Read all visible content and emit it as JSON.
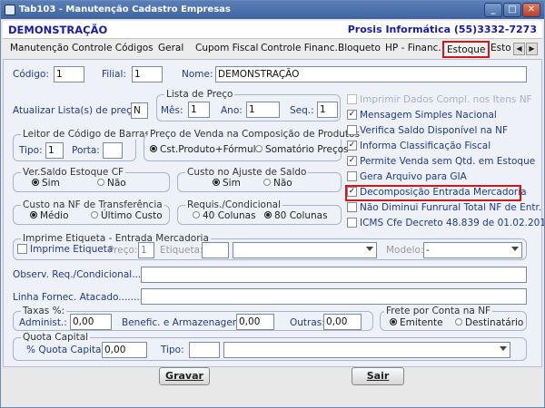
{
  "window": {
    "title": "Tab103 - Manutenção Cadastro Empresas"
  },
  "header": {
    "company": "DEMONSTRAÇÃO",
    "vendor": "Prosis Informática (55)3332-7273"
  },
  "tabs": [
    "Manutenção",
    "Controle Códigos",
    "Geral",
    "Cupom Fiscal",
    "Controle Financ.",
    "Bloqueto",
    "HP - Financ.",
    "Estoque",
    "Esto"
  ],
  "active_tab": "Estoque",
  "fields": {
    "codigo_label": "Código:",
    "codigo_value": "1",
    "filial_label": "Filial:",
    "filial_value": "1",
    "nome_label": "Nome:",
    "nome_value": "DEMONSTRAÇÃO",
    "atualizar_label": "Atualizar Lista(s) de preço:",
    "atualizar_value": "N"
  },
  "lista_preco": {
    "title": "Lista de Preço",
    "mes_label": "Mês:",
    "mes_value": "1",
    "ano_label": "Ano:",
    "ano_value": "1",
    "seq_label": "Seq.:",
    "seq_value": "1"
  },
  "leitor": {
    "title": "Leitor de Código de Barras",
    "tipo_label": "Tipo:",
    "tipo_value": "1",
    "porta_label": "Porta:",
    "porta_value": ""
  },
  "preco_venda": {
    "title": "Preço de Venda na Composição de Produtos",
    "opt1": "Cst.Produto+Fórmula",
    "opt2": "Somatório Preços"
  },
  "ver_saldo": {
    "title": "Ver.Saldo Estoque CF",
    "sim": "Sim",
    "nao": "Não"
  },
  "custo_ajuste": {
    "title": "Custo no Ajuste de Saldo",
    "sim": "Sim",
    "nao": "Não"
  },
  "custo_nf": {
    "title": "Custo na NF de Transferência",
    "opt1": "Médio",
    "opt2": "Último Custo"
  },
  "requis": {
    "title": "Requis./Condicional",
    "opt1": "40 Colunas",
    "opt2": "80 Colunas"
  },
  "checks": [
    {
      "label": "Imprimir Dados Compl. nos Itens NF",
      "checked": false,
      "enabled": false
    },
    {
      "label": "Mensagem Simples Nacional",
      "checked": true,
      "enabled": true
    },
    {
      "label": "Verifica Saldo Disponível na NF",
      "checked": false,
      "enabled": true
    },
    {
      "label": "Informa Classificação Fiscal",
      "checked": true,
      "enabled": true
    },
    {
      "label": "Permite Venda sem Qtd. em Estoque",
      "checked": true,
      "enabled": true
    },
    {
      "label": "Gera Arquivo para GIA",
      "checked": false,
      "enabled": true
    },
    {
      "label": "Decomposição Entrada Mercadoria",
      "checked": true,
      "enabled": true
    },
    {
      "label": "Não Diminui Funrural Total NF de Entr.",
      "checked": false,
      "enabled": true
    },
    {
      "label": "ICMS Cfe Decreto 48.839 de 01.02.2012",
      "checked": false,
      "enabled": true
    }
  ],
  "imprime": {
    "title": "Imprime Etiqueta - Entrada Mercadoria",
    "chk_label": "Imprime Etiqueta",
    "preco_label": "Preço:",
    "preco_value": "1",
    "etiqueta_label": "Etiqueta:",
    "modelo_label": "Modelo:",
    "modelo_value": "-"
  },
  "observ": {
    "label": "Observ. Req./Condicional....:"
  },
  "linha": {
    "label": "Linha Fornec. Atacado.........:"
  },
  "taxas": {
    "title": "Taxas %:",
    "admin_label": "Administ.:",
    "admin_value": "0,00",
    "benef_label": "Benefic. e Armazenagem:",
    "benef_value": "0,00",
    "outras_label": "Outras:",
    "outras_value": "0,00"
  },
  "frete": {
    "title": "Frete por Conta na NF",
    "opt1": "Emitente",
    "opt2": "Destinatário"
  },
  "quota": {
    "title": "Quota Capital",
    "label": "% Quota Capital:",
    "value": "0,00",
    "tipo_label": "Tipo:"
  },
  "buttons": {
    "gravar": "Gravar",
    "sair": "Sair"
  },
  "colors": {
    "title_bar": "#4a6ea8",
    "label_blue": "#1f3a8c",
    "highlight_red": "#d01818"
  }
}
